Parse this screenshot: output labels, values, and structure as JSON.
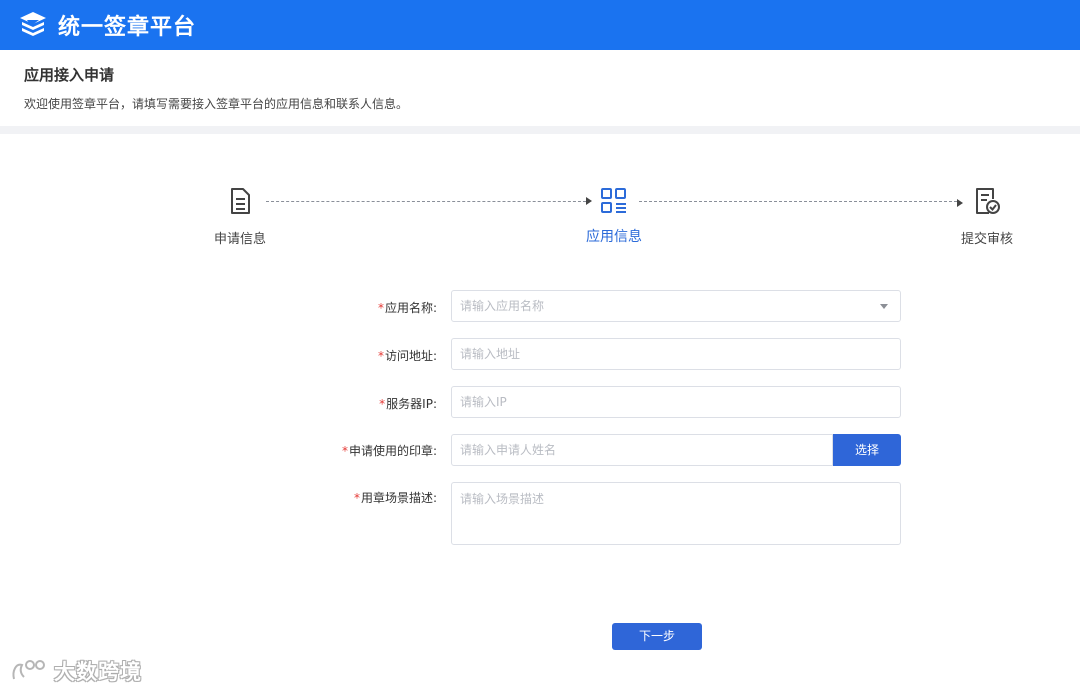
{
  "header": {
    "title": "统一签章平台",
    "logo_icon": "stacked-layers-logo",
    "bg_color": "#1a73f0"
  },
  "page": {
    "title": "应用接入申请",
    "description": "欢迎使用签章平台，请填写需要接入签章平台的应用信息和联系人信息。"
  },
  "steps": [
    {
      "label": "申请信息",
      "icon": "document-icon",
      "active": false
    },
    {
      "label": "应用信息",
      "icon": "grid-list-icon",
      "active": true
    },
    {
      "label": "提交审核",
      "icon": "document-check-icon",
      "active": false
    }
  ],
  "form": {
    "required_mark": "*",
    "app_name": {
      "label": "应用名称:",
      "placeholder": "请输入应用名称"
    },
    "access_url": {
      "label": "访问地址:",
      "placeholder": "请输入地址"
    },
    "server_ip": {
      "label": "服务器IP:",
      "placeholder": "请输入IP"
    },
    "seal": {
      "label": "申请使用的印章:",
      "placeholder": "请输入申请人姓名",
      "button": "选择"
    },
    "scenario": {
      "label": "用章场景描述:",
      "placeholder": "请输入场景描述"
    }
  },
  "next_button": "下一步",
  "watermark": {
    "text": "大数跨境"
  },
  "colors": {
    "accent": "#2f66d8",
    "required": "#e53935"
  }
}
